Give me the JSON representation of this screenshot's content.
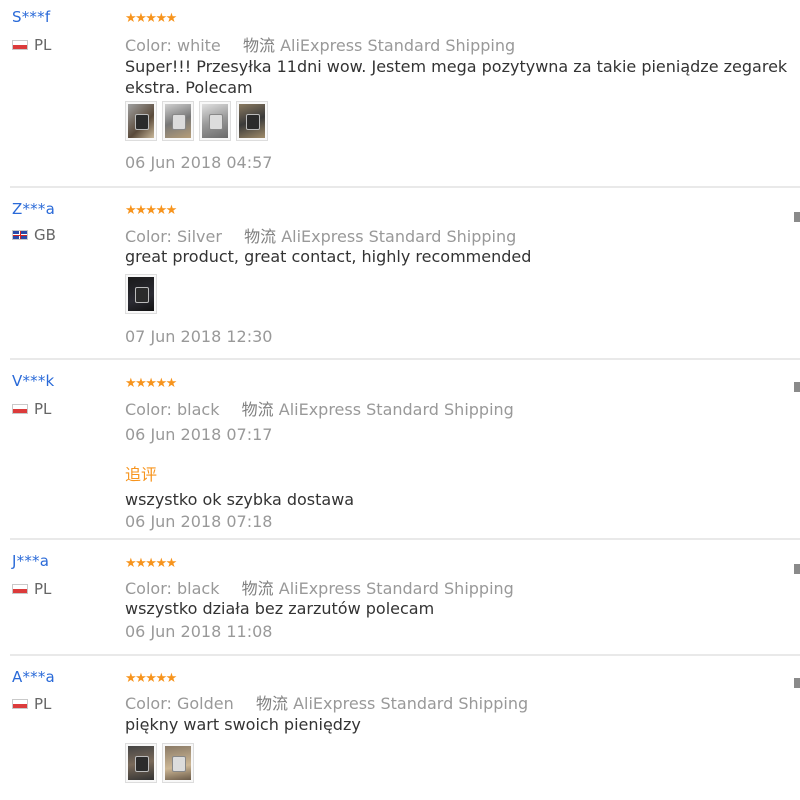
{
  "reviews": [
    {
      "user": "S***f",
      "country": "PL",
      "flag": "pl",
      "stars": "★★★★★",
      "color_label": "Color:",
      "color_value": "white",
      "logistics_label": "物流",
      "logistics_value": "AliExpress Standard Shipping",
      "text": "Super!!! Przesyłka 11dni wow. Jestem mega pozytywna za takie pieniądze zegarek ekstra. Polecam",
      "photo_count": 4,
      "date": "06 Jun 2018 04:57"
    },
    {
      "user": "Z***a",
      "country": "GB",
      "flag": "gb",
      "stars": "★★★★★",
      "color_label": "Color:",
      "color_value": "Silver",
      "logistics_label": "物流",
      "logistics_value": "AliExpress Standard Shipping",
      "text": "great product, great contact, highly recommended",
      "photo_count": 1,
      "date": "07 Jun 2018 12:30"
    },
    {
      "user": "V***k",
      "country": "PL",
      "flag": "pl",
      "stars": "★★★★★",
      "color_label": "Color:",
      "color_value": "black",
      "logistics_label": "物流",
      "logistics_value": "AliExpress Standard Shipping",
      "date": "06 Jun 2018 07:17",
      "additional_label": "追评",
      "additional_text": "wszystko ok szybka dostawa",
      "additional_date": "06 Jun 2018 07:18"
    },
    {
      "user": "J***a",
      "country": "PL",
      "flag": "pl",
      "stars": "★★★★★",
      "color_label": "Color:",
      "color_value": "black",
      "logistics_label": "物流",
      "logistics_value": "AliExpress Standard Shipping",
      "text": "wszystko działa bez zarzutów polecam",
      "date": "06 Jun 2018 11:08"
    },
    {
      "user": "A***a",
      "country": "PL",
      "flag": "pl",
      "stars": "★★★★★",
      "color_label": "Color:",
      "color_value": "Golden",
      "logistics_label": "物流",
      "logistics_value": "AliExpress Standard Shipping",
      "text": "piękny wart swoich pieniędzy",
      "photo_count": 2
    }
  ],
  "colors": {
    "user_name": "#2a6ad8",
    "stars": "#f7941d",
    "muted": "#999999",
    "text": "#333333",
    "additional": "#f7941d",
    "divider": "#e9e9e9"
  },
  "icons": {
    "star": "star-icon",
    "flag_pl": "poland-flag-icon",
    "flag_gb": "uk-flag-icon",
    "scroll": "scrollbar-marker-icon"
  }
}
